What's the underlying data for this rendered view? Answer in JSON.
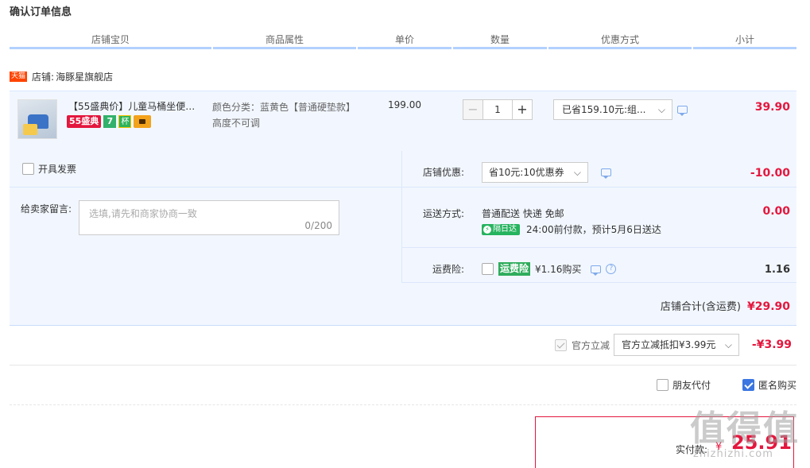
{
  "page": {
    "title": "确认订单信息"
  },
  "columns": [
    "店铺宝贝",
    "商品属性",
    "单价",
    "数量",
    "优惠方式",
    "小计"
  ],
  "shop": {
    "badge": "天猫",
    "label": "店铺:",
    "name": "海豚星旗舰店"
  },
  "item": {
    "title": "【55盛典价】儿童马桶坐便器...",
    "tags": {
      "festival": "55盛典",
      "seven": "7",
      "cup": "杯"
    },
    "attr_color": "颜色分类：蓝黄色【普通硬垫款】",
    "attr_height": "高度不可调",
    "unit_price": "199.00",
    "qty_minus": "−",
    "qty_value": "1",
    "qty_plus": "+",
    "discount": "已省159.10元:组...",
    "subtotal": "39.90"
  },
  "invoice": {
    "label": "开具发票",
    "checked": false
  },
  "message": {
    "label": "给卖家留言:",
    "placeholder": "选填,请先和商家协商一致",
    "counter": "0/200"
  },
  "shop_coupon": {
    "label": "店铺优惠:",
    "value": "省10元:10优惠券",
    "amount": "-10.00"
  },
  "shipping": {
    "label": "运送方式:",
    "method": "普通配送 快递 免邮",
    "badge": "隔日达",
    "note": "24:00前付款，预计5月6日送达",
    "amount": "0.00"
  },
  "insurance": {
    "label": "运费险:",
    "badge": "运费险",
    "price": "¥1.16购买",
    "amount": "1.16",
    "checked": false
  },
  "shop_total": {
    "label": "店铺合计(含运费)",
    "value": "¥29.90"
  },
  "official": {
    "label": "官方立减",
    "value": "官方立减抵扣¥3.99元",
    "amount": "-¥3.99",
    "checked": true
  },
  "options": {
    "friend_pay": "朋友代付",
    "friend_checked": false,
    "anonymous": "匿名购买",
    "anonymous_checked": true
  },
  "payment": {
    "label": "实付款:",
    "currency": "¥",
    "amount": "25.91"
  },
  "watermark": {
    "main": "值得值",
    "sub": "zhizhizhi.com"
  },
  "colors": {
    "accent_red": "#e4173e",
    "row_bg": "#f2f7ff",
    "header_line": "#b2d1ff",
    "check_blue": "#3b76e1"
  }
}
